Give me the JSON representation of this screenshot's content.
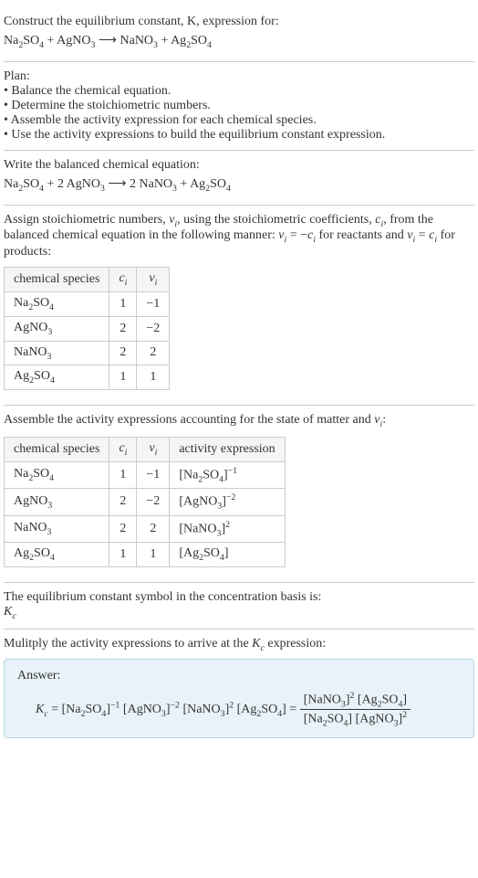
{
  "header": {
    "prompt": "Construct the equilibrium constant, K, expression for:",
    "equation_html": "Na<sub>2</sub>SO<sub>4</sub> + AgNO<sub>3</sub> ⟶ NaNO<sub>3</sub> + Ag<sub>2</sub>SO<sub>4</sub>"
  },
  "plan": {
    "title": "Plan:",
    "items": [
      "• Balance the chemical equation.",
      "• Determine the stoichiometric numbers.",
      "• Assemble the activity expression for each chemical species.",
      "• Use the activity expressions to build the equilibrium constant expression."
    ]
  },
  "balanced": {
    "instruction": "Write the balanced chemical equation:",
    "equation_html": "Na<sub>2</sub>SO<sub>4</sub> + 2 AgNO<sub>3</sub> ⟶ 2 NaNO<sub>3</sub> + Ag<sub>2</sub>SO<sub>4</sub>"
  },
  "stoich": {
    "instruction_html": "Assign stoichiometric numbers, <i>ν<sub>i</sub></i>, using the stoichiometric coefficients, <i>c<sub>i</sub></i>, from the balanced chemical equation in the following manner: <i>ν<sub>i</sub></i> = −<i>c<sub>i</sub></i> for reactants and <i>ν<sub>i</sub></i> = <i>c<sub>i</sub></i> for products:",
    "headers": {
      "species": "chemical species",
      "ci_html": "<i>c<sub>i</sub></i>",
      "vi_html": "<i>ν<sub>i</sub></i>"
    },
    "rows": [
      {
        "species_html": "Na<sub>2</sub>SO<sub>4</sub>",
        "ci": "1",
        "vi": "−1"
      },
      {
        "species_html": "AgNO<sub>3</sub>",
        "ci": "2",
        "vi": "−2"
      },
      {
        "species_html": "NaNO<sub>3</sub>",
        "ci": "2",
        "vi": "2"
      },
      {
        "species_html": "Ag<sub>2</sub>SO<sub>4</sub>",
        "ci": "1",
        "vi": "1"
      }
    ]
  },
  "activity": {
    "instruction_html": "Assemble the activity expressions accounting for the state of matter and <i>ν<sub>i</sub></i>:",
    "headers": {
      "species": "chemical species",
      "ci_html": "<i>c<sub>i</sub></i>",
      "vi_html": "<i>ν<sub>i</sub></i>",
      "expr": "activity expression"
    },
    "rows": [
      {
        "species_html": "Na<sub>2</sub>SO<sub>4</sub>",
        "ci": "1",
        "vi": "−1",
        "expr_html": "[Na<sub>2</sub>SO<sub>4</sub>]<sup>−1</sup>"
      },
      {
        "species_html": "AgNO<sub>3</sub>",
        "ci": "2",
        "vi": "−2",
        "expr_html": "[AgNO<sub>3</sub>]<sup>−2</sup>"
      },
      {
        "species_html": "NaNO<sub>3</sub>",
        "ci": "2",
        "vi": "2",
        "expr_html": "[NaNO<sub>3</sub>]<sup>2</sup>"
      },
      {
        "species_html": "Ag<sub>2</sub>SO<sub>4</sub>",
        "ci": "1",
        "vi": "1",
        "expr_html": "[Ag<sub>2</sub>SO<sub>4</sub>]"
      }
    ]
  },
  "symbol": {
    "line1": "The equilibrium constant symbol in the concentration basis is:",
    "line2_html": "<i>K<sub>c</sub></i>"
  },
  "multiply": {
    "instruction_html": "Mulitply the activity expressions to arrive at the <i>K<sub>c</sub></i> expression:"
  },
  "answer": {
    "label": "Answer:",
    "lhs_html": "<i>K<sub>c</sub></i> = [Na<sub>2</sub>SO<sub>4</sub>]<sup>−1</sup> [AgNO<sub>3</sub>]<sup>−2</sup> [NaNO<sub>3</sub>]<sup>2</sup> [Ag<sub>2</sub>SO<sub>4</sub>] = ",
    "frac_num_html": "[NaNO<sub>3</sub>]<sup>2</sup> [Ag<sub>2</sub>SO<sub>4</sub>]",
    "frac_den_html": "[Na<sub>2</sub>SO<sub>4</sub>] [AgNO<sub>3</sub>]<sup>2</sup>"
  }
}
